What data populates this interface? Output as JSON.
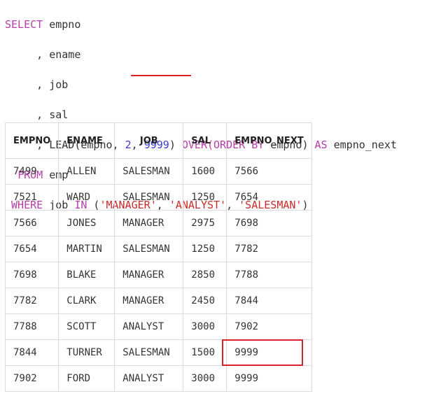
{
  "sql": {
    "select_kw": "SELECT",
    "col1": "empno",
    "comma": ",",
    "col2": "ename",
    "col3": "job",
    "col4": "sal",
    "lead_fn": "LEAD(empno, ",
    "lead_offset": "2",
    "lead_sep": ", ",
    "lead_default": "9999",
    "lead_close": ") ",
    "over_kw": "OVER",
    "order_open": "(",
    "orderby_kw": "ORDER BY",
    "order_col": " empno) ",
    "as_kw": "AS",
    "alias": " empno_next",
    "from_kw": "FROM",
    "table": " emp",
    "where_kw": "WHERE",
    "where_col": " job ",
    "in_kw": "IN",
    "in_open": " (",
    "v1": "'MANAGER'",
    "sep": ", ",
    "v2": "'ANALYST'",
    "v3": "'SALESMAN'",
    "in_close": ")"
  },
  "table": {
    "headers": [
      "EMPNO",
      "ENAME",
      "JOB",
      "SAL",
      "EMPNO_NEXT"
    ],
    "rows": [
      [
        "7499",
        "ALLEN",
        "SALESMAN",
        "1600",
        "7566"
      ],
      [
        "7521",
        "WARD",
        "SALESMAN",
        "1250",
        "7654"
      ],
      [
        "7566",
        "JONES",
        "MANAGER",
        "2975",
        "7698"
      ],
      [
        "7654",
        "MARTIN",
        "SALESMAN",
        "1250",
        "7782"
      ],
      [
        "7698",
        "BLAKE",
        "MANAGER",
        "2850",
        "7788"
      ],
      [
        "7782",
        "CLARK",
        "MANAGER",
        "2450",
        "7844"
      ],
      [
        "7788",
        "SCOTT",
        "ANALYST",
        "3000",
        "7902"
      ],
      [
        "7844",
        "TURNER",
        "SALESMAN",
        "1500",
        "9999"
      ],
      [
        "7902",
        "FORD",
        "ANALYST",
        "3000",
        "9999"
      ]
    ]
  },
  "colors": {
    "keyword": "#b83caa",
    "number": "#3b3bd6",
    "string": "#c92a2a",
    "highlight": "#d8232a"
  }
}
